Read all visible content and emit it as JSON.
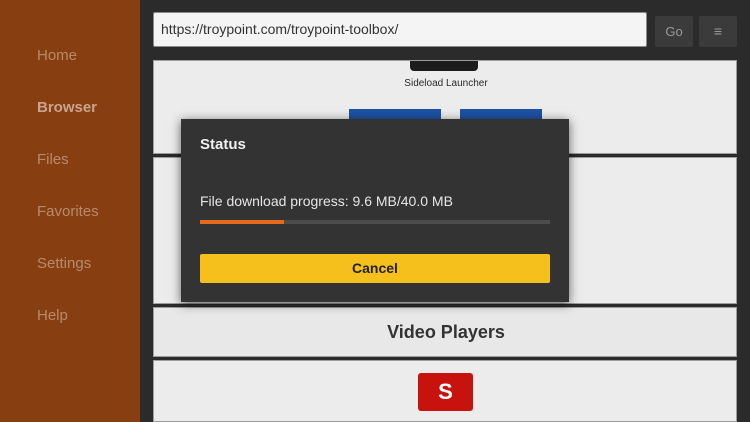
{
  "sidebar": {
    "items": [
      {
        "label": "Home"
      },
      {
        "label": "Browser",
        "active": true
      },
      {
        "label": "Files"
      },
      {
        "label": "Favorites"
      },
      {
        "label": "Settings"
      },
      {
        "label": "Help"
      }
    ]
  },
  "topbar": {
    "url": "https://troypoint.com/troypoint-toolbox/",
    "go_label": "Go",
    "menu_icon": "≡"
  },
  "page": {
    "launcher_label": "Sideload Launcher",
    "section_title": "Video Players",
    "app_logo_letter": "S"
  },
  "dialog": {
    "title": "Status",
    "progress_text": "File download progress: 9.6 MB/40.0 MB",
    "progress_fraction": 0.24,
    "cancel_label": "Cancel"
  },
  "colors": {
    "sidebar": "#873f12",
    "accent_progress": "#e46a1e",
    "cancel_button": "#f6c01c",
    "tile_blue": "#1d52a4",
    "logo_red": "#c7120d"
  }
}
